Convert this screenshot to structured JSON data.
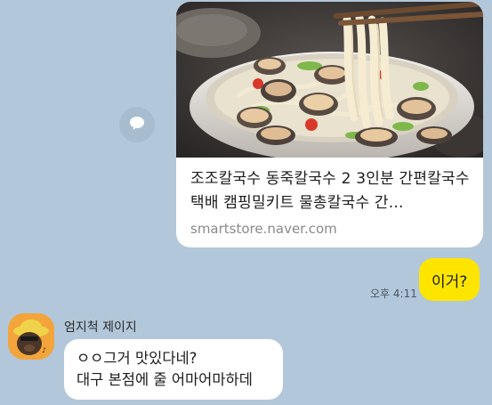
{
  "link_card": {
    "title": "조조칼국수 동죽칼국수 2 3인분 간편칼국수 택배 캠핑밀키트 물총칼국수 간...",
    "domain": "smartstore.naver.com",
    "thumbnail_alt": "bowl of clam kalguksu noodles with chopsticks lifting noodles"
  },
  "share_button": {
    "icon": "speech-bubble-icon"
  },
  "outgoing": {
    "text": "이거?",
    "time": "오후 4:11",
    "color": "#fee500"
  },
  "incoming": {
    "sender": "엄지척 제이지",
    "lines": [
      "ㅇㅇ그거 맛있다네?",
      "대구 본점에 줄 어마어마하데"
    ],
    "avatar": "jay-g-character-avatar"
  },
  "colors": {
    "background": "#b2c7da",
    "bubble_other": "#ffffff"
  }
}
